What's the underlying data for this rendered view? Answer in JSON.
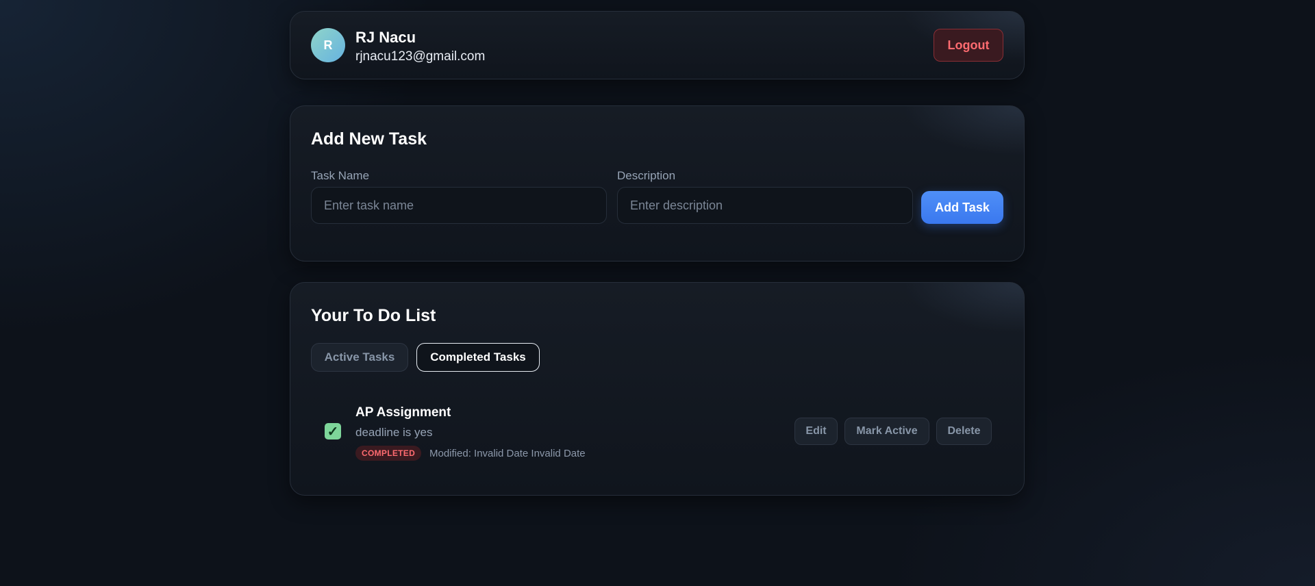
{
  "user": {
    "avatar_initial": "R",
    "name": "RJ Nacu",
    "email": "rjnacu123@gmail.com",
    "logout_label": "Logout"
  },
  "add_task": {
    "title": "Add New Task",
    "task_name_label": "Task Name",
    "task_name_placeholder": "Enter task name",
    "task_name_value": "",
    "description_label": "Description",
    "description_placeholder": "Enter description",
    "description_value": "",
    "submit_label": "Add Task"
  },
  "todo": {
    "title": "Your To Do List",
    "tabs": [
      {
        "label": "Active Tasks",
        "selected": false
      },
      {
        "label": "Completed Tasks",
        "selected": true
      }
    ],
    "tasks": [
      {
        "checked": true,
        "check_glyph": "✓",
        "name": "AP Assignment",
        "description": "deadline is yes",
        "status": "COMPLETED",
        "modified": "Modified: Invalid Date Invalid Date",
        "actions": [
          "Edit",
          "Mark Active",
          "Delete"
        ]
      }
    ]
  },
  "colors": {
    "background": "#0d121a",
    "card": "#131922",
    "accent_blue": "#3a78ef",
    "danger": "#ff6b70",
    "success": "#7ed69a"
  }
}
